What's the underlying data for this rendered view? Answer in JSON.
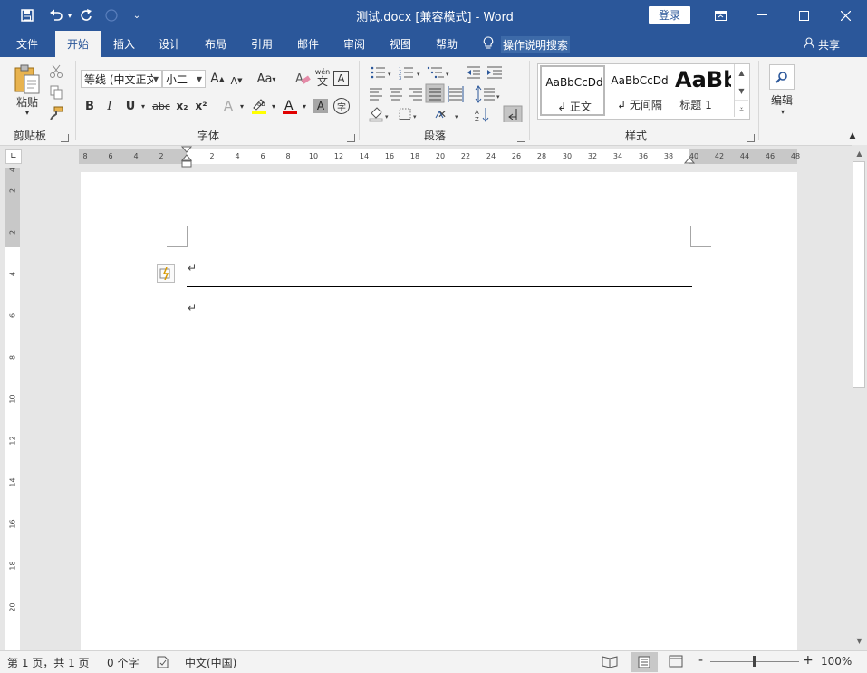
{
  "title_bar": {
    "doc_title": "测试.docx [兼容模式]  -  Word",
    "login_label": "登录",
    "qa_save_icon": "save-icon",
    "qa_undo_icon": "undo-icon",
    "qa_redo_icon": "redo-icon",
    "qa_touch_icon": "touch-mode-icon",
    "qa_customize_icon": "customize-icon"
  },
  "tabs": [
    {
      "label": "文件"
    },
    {
      "label": "开始"
    },
    {
      "label": "插入"
    },
    {
      "label": "设计"
    },
    {
      "label": "布局"
    },
    {
      "label": "引用"
    },
    {
      "label": "邮件"
    },
    {
      "label": "审阅"
    },
    {
      "label": "视图"
    },
    {
      "label": "帮助"
    }
  ],
  "tell_me": {
    "label": "操作说明搜索"
  },
  "share": {
    "label": "共享"
  },
  "ribbon": {
    "clipboard": {
      "paste_label": "粘贴",
      "group_label": "剪贴板"
    },
    "font": {
      "font_name": "等线 (中文正文",
      "font_size": "小二",
      "grow": "A",
      "shrink": "A",
      "change_case": "Aa",
      "phonetic_top": "wén",
      "phonetic_bottom": "文",
      "bold": "B",
      "italic": "I",
      "underline": "U",
      "strike": "abc",
      "subscript": "x₂",
      "superscript": "x²",
      "text_effects": "A",
      "font_color": "A",
      "char_shading": "A",
      "enclosed": "字",
      "border_char": "A",
      "group_label": "字体",
      "highlight_color": "#ffff00",
      "font_color_value": "#e00000"
    },
    "paragraph": {
      "group_label": "段落"
    },
    "styles": {
      "items": [
        {
          "preview": "AaBbCcDd",
          "name": "↲ 正文"
        },
        {
          "preview": "AaBbCcDd",
          "name": "↲ 无间隔"
        },
        {
          "preview": "AaBb",
          "name": "标题 1"
        }
      ],
      "group_label": "样式"
    },
    "editing": {
      "label": "编辑"
    }
  },
  "ruler": {
    "h_ticks": [
      "8",
      "6",
      "4",
      "2",
      "",
      "2",
      "4",
      "6",
      "8",
      "10",
      "12",
      "14",
      "16",
      "18",
      "20",
      "22",
      "24",
      "26",
      "28",
      "30",
      "32",
      "34",
      "36",
      "38",
      "40",
      "42",
      "44",
      "46",
      "48"
    ],
    "v_ticks": [
      "4",
      "2",
      "",
      "2",
      "",
      "4",
      "",
      "6",
      "",
      "8",
      "",
      "10",
      "",
      "12",
      "",
      "14",
      "",
      "16",
      "",
      "18",
      "",
      "20"
    ]
  },
  "document": {
    "para_mark_1": "↵",
    "para_mark_2": "↵"
  },
  "status_bar": {
    "page": "第 1 页，共 1 页",
    "words": "0 个字",
    "language": "中文(中国)",
    "zoom": "100%",
    "zoom_minus": "-",
    "zoom_plus": "+"
  }
}
